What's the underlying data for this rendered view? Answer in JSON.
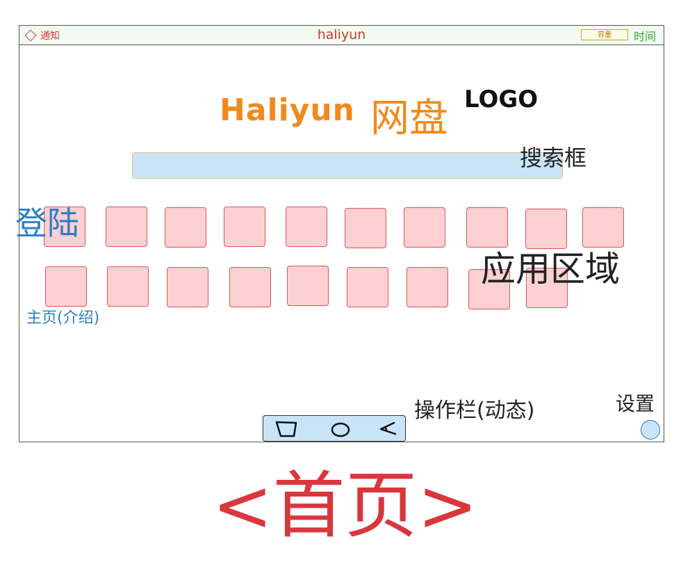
{
  "topbar": {
    "notify_label": "通知",
    "title": "haliyun",
    "capacity_label": "容量",
    "time_label": "时间"
  },
  "logo": {
    "brand": "Haliyun",
    "product": "网盘",
    "tag": "LOGO"
  },
  "search": {
    "annotation": "搜索框"
  },
  "sidebar": {
    "login_label": "登陆",
    "home_label": "主页(介绍)"
  },
  "apps": {
    "annotation": "应用区域"
  },
  "toolbar": {
    "annotation": "操作栏(动态)",
    "icons": [
      "square-icon",
      "circle-icon",
      "triangle-back-icon"
    ]
  },
  "settings": {
    "label": "设置"
  },
  "caption": "<首页>"
}
